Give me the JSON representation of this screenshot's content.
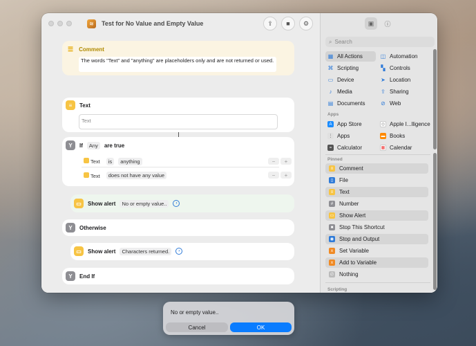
{
  "window": {
    "title": "Test for No Value and Empty Value"
  },
  "comment": {
    "label": "Comment",
    "text": "The words \"Text\" and \"anything\" are placeholders only and are not returned or used."
  },
  "text_action": {
    "label": "Text",
    "placeholder": "Text"
  },
  "if_action": {
    "if_label": "If",
    "any_token": "Any",
    "are_true": "are true",
    "conditions": [
      {
        "var": "Text",
        "op": "is",
        "value": "anything"
      },
      {
        "var": "Text",
        "op": "does not have any value",
        "value": ""
      }
    ],
    "minus": "−",
    "plus": "+"
  },
  "show_alert_1": {
    "label": "Show alert",
    "value": "No or empty value.."
  },
  "otherwise": {
    "label": "Otherwise"
  },
  "show_alert_2": {
    "label": "Show alert",
    "value": "Characters returned."
  },
  "end_if": {
    "label": "End If"
  },
  "sidebar": {
    "search_placeholder": "Search",
    "categories_left": [
      "All Actions",
      "Scripting",
      "Device",
      "Media",
      "Documents"
    ],
    "categories_right": [
      "Automation",
      "Controls",
      "Location",
      "Sharing",
      "Web"
    ],
    "apps_header": "Apps",
    "apps_left": [
      "App Store",
      "Apps",
      "Calculator"
    ],
    "apps_right": [
      "Apple I...lligence",
      "Books",
      "Calendar"
    ],
    "pinned_header": "Pinned",
    "pinned": [
      "Comment",
      "File",
      "Text",
      "Number",
      "Show Alert",
      "Stop This Shortcut",
      "Stop and Output",
      "Set Variable",
      "Add to Variable",
      "Nothing"
    ],
    "scripting_header": "Scripting"
  },
  "dialog": {
    "message": "No or empty value..",
    "cancel": "Cancel",
    "ok": "OK"
  },
  "colors": {
    "accent": "#0a7cff",
    "action_yellow": "#f7c443",
    "control_gray": "#8e8e93"
  }
}
